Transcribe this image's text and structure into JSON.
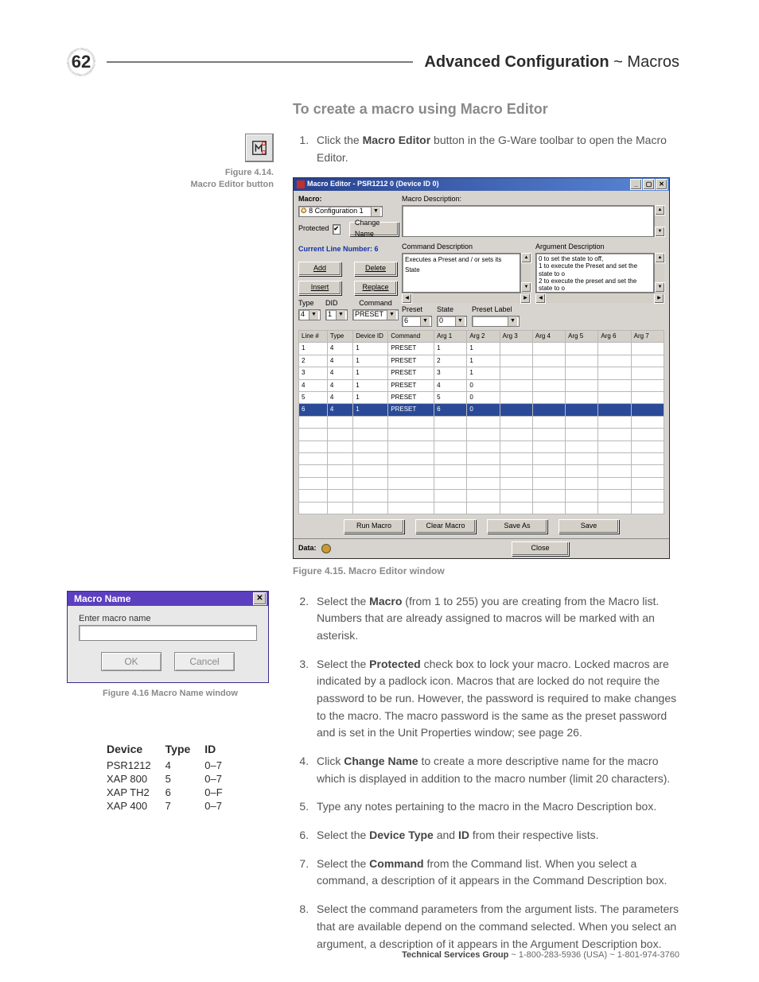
{
  "header": {
    "page_number": "62",
    "title_strong": "Advanced Configuration",
    "title_sep": " ~ ",
    "title_light": "Macros"
  },
  "section_title": "To create a macro using Macro Editor",
  "side": {
    "fig414_a": "Figure 4.14.",
    "fig414_b": "Macro Editor button",
    "fig416": "Figure 4.16 Macro Name window"
  },
  "fig415": "Figure 4.15. Macro Editor window",
  "steps": {
    "s1_a": "Click the ",
    "s1_b": "Macro Editor",
    "s1_c": " button in the G-Ware toolbar to open the Macro Editor.",
    "s2_a": "Select the ",
    "s2_b": "Macro",
    "s2_c": " (from 1 to 255) you are creating from the Macro list. Numbers that are already assigned to macros will be marked with an asterisk.",
    "s3_a": "Select the ",
    "s3_b": "Protected",
    "s3_c": " check box to lock your macro. Locked macros are indicated by a padlock icon. Macros that are locked do not require the password to be run. However, the password is required to make changes to the macro. The macro password is the same as the preset password and is set in the Unit Properties window; see page 26.",
    "s4_a": "Click ",
    "s4_b": "Change Name",
    "s4_c": " to create a more descriptive name for the macro which is displayed in addition to the macro number (limit 20 characters).",
    "s5": "Type any notes pertaining to the macro in the Macro Description box.",
    "s6_a": "Select the ",
    "s6_b": "Device Type",
    "s6_c": " and ",
    "s6_d": "ID",
    "s6_e": " from their respective lists.",
    "s7_a": "Select the ",
    "s7_b": "Command",
    "s7_c": " from the Command list. When you select a command, a description of it appears in the Command Description box.",
    "s8": "Select the command parameters from the argument lists. The parameters that are available depend on the command selected. When you select an argument, a description of it appears in the Argument Description box."
  },
  "macro_editor": {
    "title": "Macro Editor - PSR1212 0 (Device ID 0)",
    "lbl_macro": "Macro:",
    "macro_sel": "8 Configuration 1",
    "lbl_protected": "Protected",
    "btn_change": "Change Name",
    "lbl_desc": "Macro Description:",
    "lbl_cur_line": "Current Line Number:  6",
    "btn_add": "Add",
    "btn_delete": "Delete",
    "btn_insert": "Insert",
    "btn_replace": "Replace",
    "lbl_cmd_desc": "Command Description",
    "cmd_desc_text": "Executes a Preset and / or sets its State",
    "lbl_arg_desc": "Argument Description",
    "arg_desc_l1": "0 to set the state to off,",
    "arg_desc_l2": "1 to execute the Preset and set the state to o",
    "arg_desc_l3": "2 to execute the preset and set the state to o",
    "lbl_type": "Type",
    "lbl_did": "DID",
    "lbl_command": "Command",
    "val_type": "4",
    "val_did": "1",
    "val_command": "PRESET",
    "lbl_preset": "Preset",
    "lbl_state": "State",
    "lbl_preset_label": "Preset Label",
    "val_preset": "6",
    "val_state": "0",
    "cols": [
      "Line #",
      "Type",
      "Device ID",
      "Command",
      "Arg 1",
      "Arg 2",
      "Arg 3",
      "Arg 4",
      "Arg 5",
      "Arg 6",
      "Arg 7"
    ],
    "rows": [
      {
        "line": "1",
        "type": "4",
        "did": "1",
        "cmd": "PRESET",
        "a1": "1",
        "a2": "1",
        "sel": false
      },
      {
        "line": "2",
        "type": "4",
        "did": "1",
        "cmd": "PRESET",
        "a1": "2",
        "a2": "1",
        "sel": false
      },
      {
        "line": "3",
        "type": "4",
        "did": "1",
        "cmd": "PRESET",
        "a1": "3",
        "a2": "1",
        "sel": false
      },
      {
        "line": "4",
        "type": "4",
        "did": "1",
        "cmd": "PRESET",
        "a1": "4",
        "a2": "0",
        "sel": false
      },
      {
        "line": "5",
        "type": "4",
        "did": "1",
        "cmd": "PRESET",
        "a1": "5",
        "a2": "0",
        "sel": false
      },
      {
        "line": "6",
        "type": "4",
        "did": "1",
        "cmd": "PRESET",
        "a1": "6",
        "a2": "0",
        "sel": true
      }
    ],
    "btn_run": "Run Macro",
    "btn_clear": "Clear Macro",
    "btn_saveas": "Save As",
    "btn_save": "Save",
    "lbl_data": "Data:",
    "btn_close": "Close"
  },
  "macro_name_dlg": {
    "title": "Macro Name",
    "label": "Enter macro name",
    "ok": "OK",
    "cancel": "Cancel"
  },
  "device_table": {
    "headers": [
      "Device",
      "Type",
      "ID"
    ],
    "rows": [
      [
        "PSR1212",
        "4",
        "0–7"
      ],
      [
        "XAP 800",
        "5",
        "0–7"
      ],
      [
        "XAP TH2",
        "6",
        "0–F"
      ],
      [
        "XAP 400",
        "7",
        "0–7"
      ]
    ]
  },
  "footer": {
    "strong": "Technical Services Group",
    "rest": " ~ 1-800-283-5936 (USA) ~ 1-801-974-3760"
  }
}
